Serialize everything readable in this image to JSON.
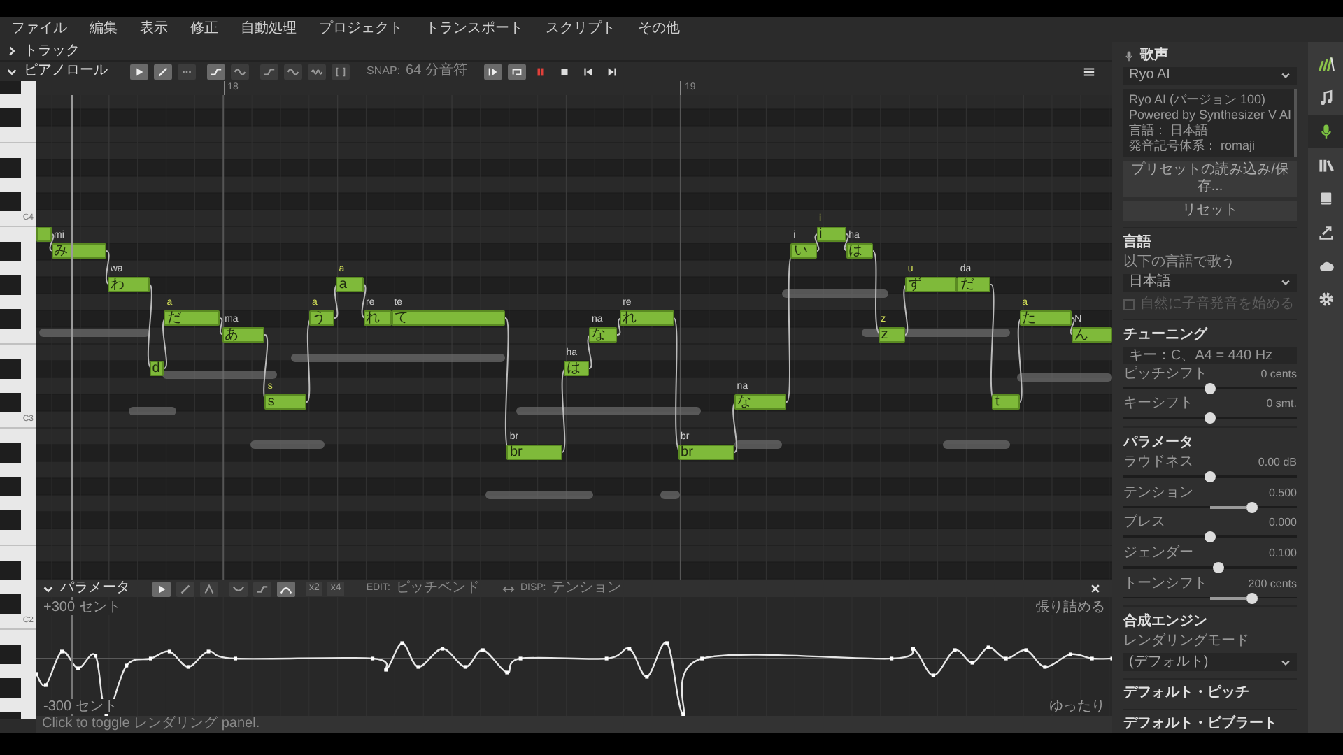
{
  "menu": [
    "ファイル",
    "編集",
    "表示",
    "修正",
    "自動処理",
    "プロジェクト",
    "トランスポート",
    "スクリプト",
    "その他"
  ],
  "track_section": {
    "label": "トラック",
    "expanded": false
  },
  "piano_roll": {
    "label": "ピアノロール",
    "expanded": true,
    "tools": [
      {
        "kind": "pointer",
        "selected": true
      },
      {
        "kind": "pen",
        "selected": true
      },
      {
        "kind": "dots",
        "selected": false
      },
      {
        "kind": "ramp",
        "selected": true
      },
      {
        "kind": "wave",
        "selected": false
      },
      {
        "kind": "ramp",
        "selected": false
      },
      {
        "kind": "wave",
        "selected": false
      },
      {
        "kind": "vibrato",
        "selected": false
      },
      {
        "kind": "brackets",
        "selected": false
      }
    ],
    "snap_label": "SNAP:",
    "snap_value": "64 分音符",
    "transport": [
      {
        "kind": "play-from-cursor",
        "on": true
      },
      {
        "kind": "loop",
        "on": true
      },
      {
        "kind": "pause",
        "on": false
      },
      {
        "kind": "stop",
        "on": false
      },
      {
        "kind": "prev",
        "on": false
      },
      {
        "kind": "next",
        "on": false
      }
    ],
    "ruler": [
      "18",
      "19"
    ],
    "keyboard_labels": [
      "C4",
      "C3",
      "C2"
    ],
    "notes": [
      {
        "selected": false
      },
      {
        "lyric": "mi",
        "lyric_edited": false,
        "text": "み",
        "selected": false
      },
      {
        "lyric": "wa",
        "lyric_edited": false,
        "text": "わ",
        "selected": false
      },
      {
        "text": "d",
        "selected": false
      },
      {
        "lyric": "a",
        "lyric_edited": true,
        "text": "だ",
        "selected": false
      },
      {
        "lyric": "ma",
        "lyric_edited": false,
        "text": "あ",
        "selected": false
      },
      {
        "lyric": "s",
        "lyric_edited": true,
        "text": "s",
        "selected": false
      },
      {
        "lyric": "a",
        "lyric_edited": true,
        "text": "う",
        "selected": false
      },
      {
        "lyric": "a",
        "lyric_edited": true,
        "text": "a",
        "selected": false
      },
      {
        "lyric": "re",
        "lyric_edited": false,
        "text": "れ",
        "selected": false
      },
      {
        "lyric": "te",
        "lyric_edited": false,
        "text": "て",
        "selected": false
      },
      {
        "lyric": "br",
        "lyric_edited": false,
        "text": "br",
        "selected": false
      },
      {
        "lyric": "ha",
        "lyric_edited": false,
        "text": "は",
        "selected": false
      },
      {
        "lyric": "na",
        "lyric_edited": false,
        "text": "な",
        "selected": false
      },
      {
        "lyric": "re",
        "lyric_edited": false,
        "text": "れ",
        "selected": false
      },
      {
        "lyric": "br",
        "lyric_edited": false,
        "text": "br",
        "selected": false
      },
      {
        "lyric": "na",
        "lyric_edited": false,
        "text": "な",
        "selected": false
      },
      {
        "lyric": "i",
        "lyric_edited": false,
        "text": "い",
        "selected": false
      },
      {
        "lyric": "i",
        "lyric_edited": true,
        "text": "i",
        "selected": false
      },
      {
        "lyric": "ha",
        "lyric_edited": false,
        "text": "は",
        "selected": false
      },
      {
        "lyric": "z",
        "lyric_edited": true,
        "text": "z",
        "selected": false
      },
      {
        "lyric": "u",
        "lyric_edited": true,
        "text": "ず",
        "selected": false
      },
      {
        "lyric": "da",
        "lyric_edited": false,
        "text": "だ",
        "selected": false
      },
      {
        "text": "t",
        "selected": false
      },
      {
        "lyric": "a",
        "lyric_edited": true,
        "text": "た",
        "selected": false
      },
      {
        "lyric": "N",
        "lyric_edited": false,
        "text": "ん",
        "selected": false
      }
    ]
  },
  "parameters_panel": {
    "label": "パラメータ",
    "expanded": true,
    "tools": [
      {
        "kind": "pointer",
        "selected": true
      },
      {
        "kind": "pen",
        "selected": false
      },
      {
        "kind": "symmetric",
        "selected": false
      },
      {
        "kind": "down-curve",
        "selected": false
      },
      {
        "kind": "ramp",
        "selected": false
      },
      {
        "kind": "arc",
        "selected": true
      }
    ],
    "multipliers": [
      "x2",
      "x4"
    ],
    "edit_label": "EDIT:",
    "edit_value": "ピッチベンド",
    "disp_label": "DISP:",
    "disp_value": "テンション",
    "top_label": "+300 セント",
    "bottom_label": "-300 セント",
    "right_top_label": "張り詰める",
    "right_bottom_label": "ゆったり"
  },
  "status_bar": "Click to toggle レンダリング panel.",
  "side_panel": {
    "voice": {
      "title": "歌声",
      "select": "Ryo AI",
      "info": [
        "Ryo AI (バージョン 100)",
        "Powered by Synthesizer V AI",
        "言語： 日本語",
        "発音記号体系： romaji"
      ],
      "buttons": [
        "プリセットの読み込み/保存...",
        "リセット"
      ]
    },
    "language": {
      "title": "言語",
      "label": "以下の言語で歌う",
      "select": "日本語",
      "checkbox": {
        "label": "自然に子音発音を始める",
        "checked": false,
        "disabled": true
      }
    },
    "tuning": {
      "title": "チューニング",
      "field": "キー：C、A4 = 440 Hz",
      "sliders": [
        {
          "label": "ピッチシフト",
          "reading": "0 cents",
          "level": 0.5
        },
        {
          "label": "キーシフト",
          "reading": "0 smt.",
          "level": 0.5
        }
      ]
    },
    "parameters": {
      "title": "パラメータ",
      "sliders": [
        {
          "label": "ラウドネス",
          "reading": "0.00 dB",
          "level": 0.5
        },
        {
          "label": "テンション",
          "reading": "0.500",
          "level": 0.74
        },
        {
          "label": "ブレス",
          "reading": "0.000",
          "level": 0.5
        },
        {
          "label": "ジェンダー",
          "reading": "0.100",
          "level": 0.55
        },
        {
          "label": "トーンシフト",
          "reading": "200 cents",
          "level": 0.74
        }
      ]
    },
    "engine": {
      "title": "合成エンジン",
      "label": "レンダリングモード",
      "select": "(デフォルト)"
    },
    "sections": [
      "デフォルト・ピッチ",
      "デフォルト・ビブラート"
    ]
  },
  "side_icons": [
    {
      "kind": "logo",
      "selected": false
    },
    {
      "kind": "music-note",
      "selected": false
    },
    {
      "kind": "microphone",
      "selected": true
    },
    {
      "kind": "books",
      "selected": false
    },
    {
      "kind": "book",
      "selected": false
    },
    {
      "kind": "export",
      "selected": false
    },
    {
      "kind": "cloud",
      "selected": false
    },
    {
      "kind": "gear",
      "selected": false
    }
  ]
}
